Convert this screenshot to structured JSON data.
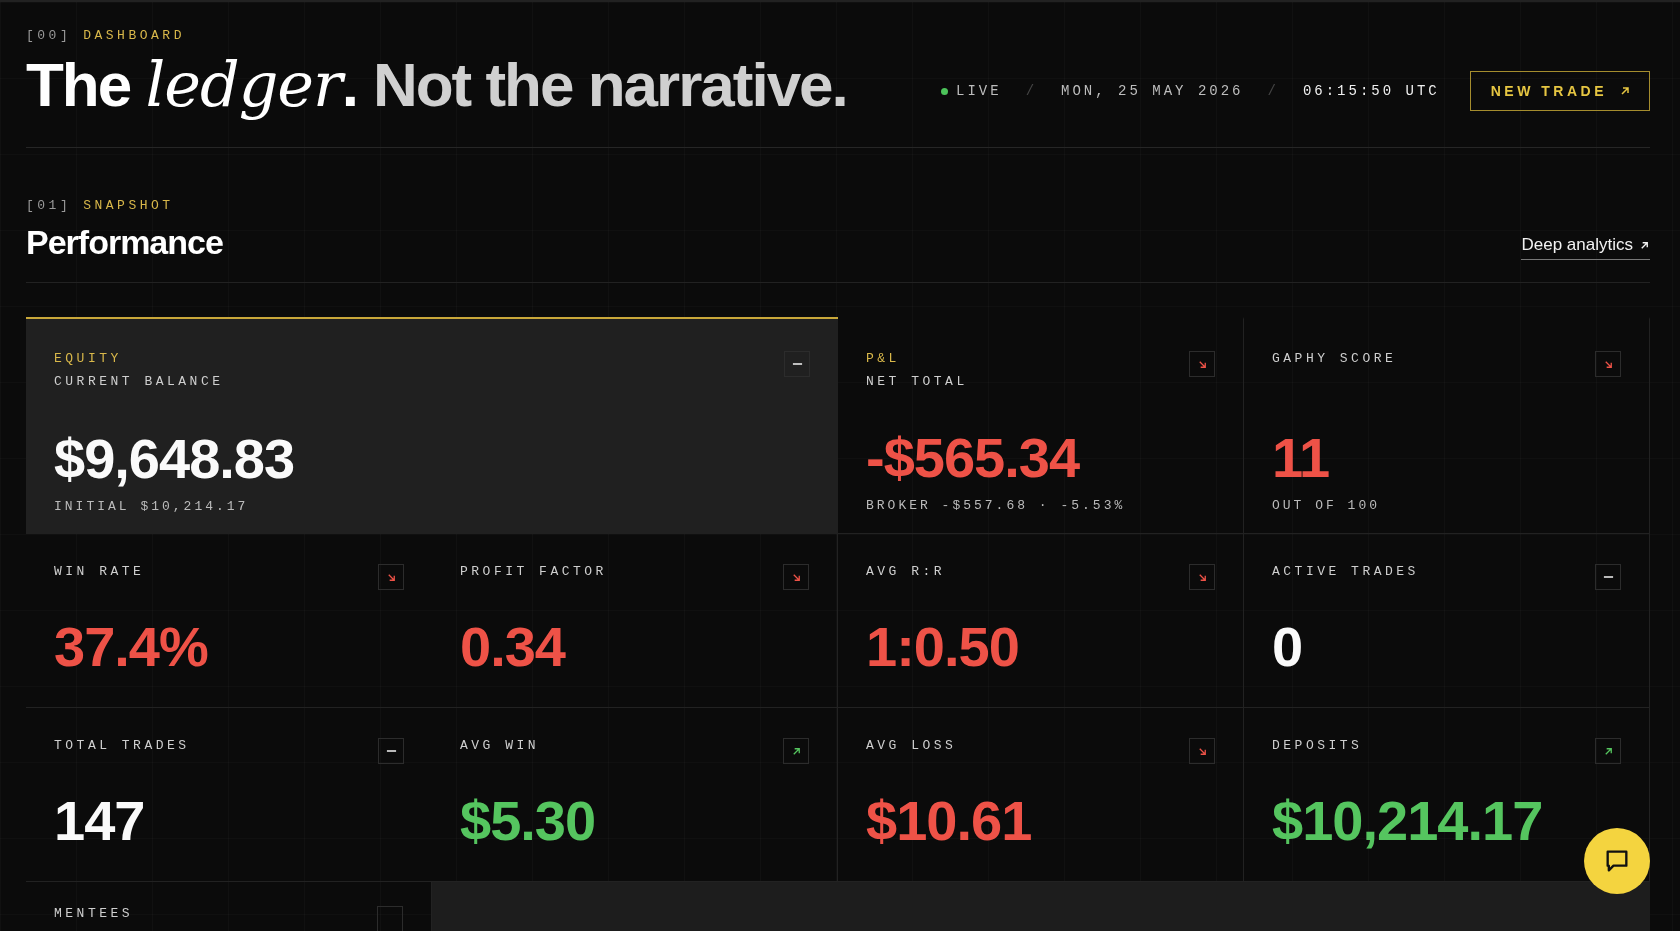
{
  "header": {
    "index": "[00]",
    "eyebrow": "DASHBOARD",
    "title_parts": [
      {
        "text": "The *ledger*.",
        "muted": false
      },
      {
        "text": "Not the narrative.",
        "muted": true
      }
    ],
    "status": [
      {
        "kind": "live",
        "text": "LIVE",
        "on": true
      },
      {
        "kind": "separator",
        "text": "/"
      },
      {
        "kind": "date",
        "text": "MON, 25 MAY 2026"
      },
      {
        "kind": "separator",
        "text": "/"
      },
      {
        "kind": "time",
        "text": "06:15:50 UTC"
      }
    ],
    "new_trade_button": {
      "label": "NEW TRADE"
    }
  },
  "section": {
    "index": "[01]",
    "eyebrow": "SNAPSHOT",
    "title": "Performance",
    "link": "Deep analytics"
  },
  "cards": [
    {
      "category": "EQUITY",
      "label": "CURRENT BALANCE",
      "value": "$9,648.83",
      "note": "INITIAL $10,214.17",
      "color": "#fafafa",
      "kind": "flat",
      "featured": true
    },
    {
      "category": "P&L",
      "label": "NET TOTAL",
      "value": "-$565.34",
      "note": "BROKER -$557.68 · -5.53%",
      "color": "#ee5247",
      "kind": "down",
      "featured": false
    },
    {
      "label": "GAPHY SCORE",
      "value": "11",
      "note": "OUT OF 100",
      "color": "#ee5247",
      "kind": "down",
      "featured": false
    },
    {
      "label": "WIN RATE",
      "value": "37.4%",
      "color": "#ee5247",
      "kind": "down",
      "featured": false
    },
    {
      "label": "PROFIT FACTOR",
      "value": "0.34",
      "color": "#ee5247",
      "kind": "down",
      "featured": false
    },
    {
      "label": "AVG R:R",
      "value": "1:0.50",
      "color": "#ee5247",
      "kind": "down",
      "featured": false
    },
    {
      "label": "ACTIVE TRADES",
      "value": "0",
      "color": "#fafafa",
      "kind": "flat",
      "featured": false
    },
    {
      "label": "TOTAL TRADES",
      "value": "147",
      "color": "#fafafa",
      "kind": "flat",
      "featured": false
    },
    {
      "label": "AVG WIN",
      "value": "$5.30",
      "color": "#55c55f",
      "kind": "up",
      "featured": false
    },
    {
      "label": "AVG LOSS",
      "value": "$10.61",
      "color": "#ee5247",
      "kind": "down",
      "featured": false
    },
    {
      "label": "DEPOSITS",
      "value": "$10,214.17",
      "color": "#55c55f",
      "kind": "up",
      "featured": false
    },
    {
      "label": "MENTEES",
      "featured": false
    }
  ]
}
